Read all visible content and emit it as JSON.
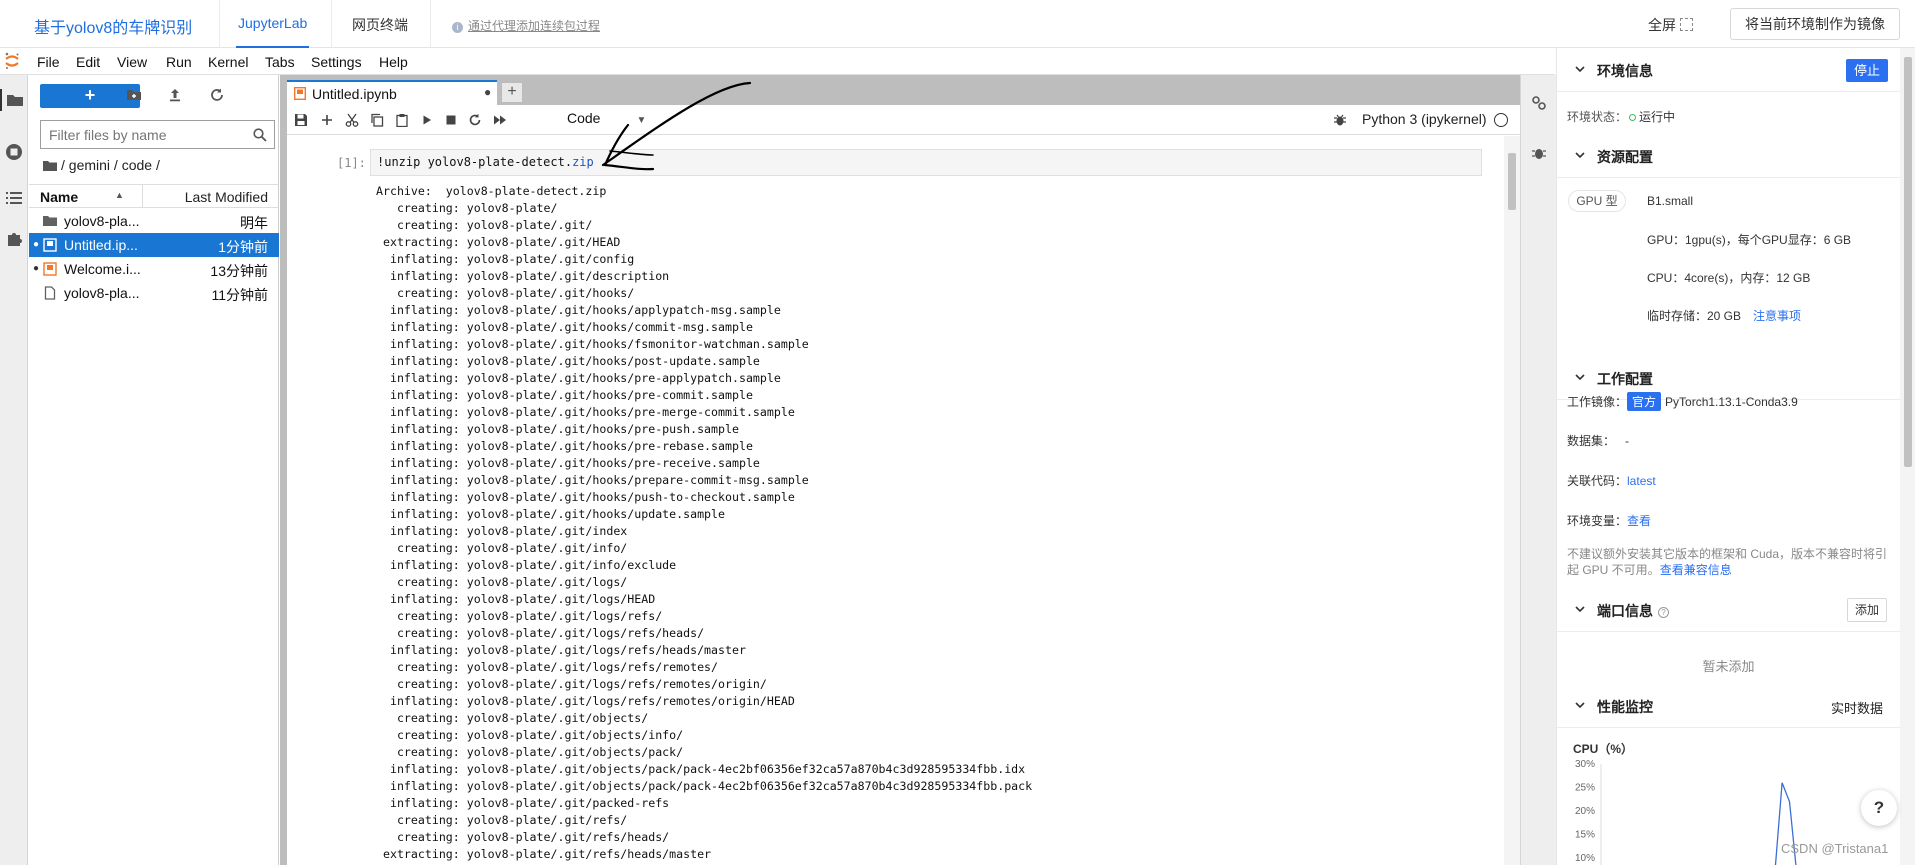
{
  "topbar": {
    "project_name": "基于yolov8的车牌识别",
    "tabs": [
      "JupyterLab",
      "网页终端"
    ],
    "proxy_link": "通过代理添加连续包过程",
    "fullscreen": "全屏",
    "mirror_button": "将当前环境制作为镜像"
  },
  "menu": [
    "File",
    "Edit",
    "View",
    "Run",
    "Kernel",
    "Tabs",
    "Settings",
    "Help"
  ],
  "filebrowser": {
    "new_button": "+",
    "filter_placeholder": "Filter files by name",
    "breadcrumb": "/ gemini / code /",
    "col_name": "Name",
    "col_modified": "Last Modified",
    "files": [
      {
        "name": "yolov8-pla...",
        "modified": "明年",
        "type": "folder",
        "running": false,
        "selected": false
      },
      {
        "name": "Untitled.ip...",
        "modified": "1分钟前",
        "type": "notebook",
        "running": true,
        "selected": true
      },
      {
        "name": "Welcome.i...",
        "modified": "13分钟前",
        "type": "notebook",
        "running": true,
        "selected": false
      },
      {
        "name": "yolov8-pla...",
        "modified": "11分钟前",
        "type": "file",
        "running": false,
        "selected": false
      }
    ]
  },
  "notebook": {
    "tab_name": "Untitled.ipynb",
    "cell_type": "Code",
    "kernel": "Python 3 (ipykernel)",
    "prompt": "[1]:",
    "code_prefix": "!unzip yolov8-plate-detect.",
    "code_ext": "zip",
    "output_lines": [
      "Archive:  yolov8-plate-detect.zip",
      "   creating: yolov8-plate/",
      "   creating: yolov8-plate/.git/",
      " extracting: yolov8-plate/.git/HEAD",
      "  inflating: yolov8-plate/.git/config",
      "  inflating: yolov8-plate/.git/description",
      "   creating: yolov8-plate/.git/hooks/",
      "  inflating: yolov8-plate/.git/hooks/applypatch-msg.sample",
      "  inflating: yolov8-plate/.git/hooks/commit-msg.sample",
      "  inflating: yolov8-plate/.git/hooks/fsmonitor-watchman.sample",
      "  inflating: yolov8-plate/.git/hooks/post-update.sample",
      "  inflating: yolov8-plate/.git/hooks/pre-applypatch.sample",
      "  inflating: yolov8-plate/.git/hooks/pre-commit.sample",
      "  inflating: yolov8-plate/.git/hooks/pre-merge-commit.sample",
      "  inflating: yolov8-plate/.git/hooks/pre-push.sample",
      "  inflating: yolov8-plate/.git/hooks/pre-rebase.sample",
      "  inflating: yolov8-plate/.git/hooks/pre-receive.sample",
      "  inflating: yolov8-plate/.git/hooks/prepare-commit-msg.sample",
      "  inflating: yolov8-plate/.git/hooks/push-to-checkout.sample",
      "  inflating: yolov8-plate/.git/hooks/update.sample",
      "  inflating: yolov8-plate/.git/index",
      "   creating: yolov8-plate/.git/info/",
      "  inflating: yolov8-plate/.git/info/exclude",
      "   creating: yolov8-plate/.git/logs/",
      "  inflating: yolov8-plate/.git/logs/HEAD",
      "   creating: yolov8-plate/.git/logs/refs/",
      "   creating: yolov8-plate/.git/logs/refs/heads/",
      "  inflating: yolov8-plate/.git/logs/refs/heads/master",
      "   creating: yolov8-plate/.git/logs/refs/remotes/",
      "   creating: yolov8-plate/.git/logs/refs/remotes/origin/",
      "  inflating: yolov8-plate/.git/logs/refs/remotes/origin/HEAD",
      "   creating: yolov8-plate/.git/objects/",
      "   creating: yolov8-plate/.git/objects/info/",
      "   creating: yolov8-plate/.git/objects/pack/",
      "  inflating: yolov8-plate/.git/objects/pack/pack-4ec2bf06356ef32ca57a870b4c3d928595334fbb.idx",
      "  inflating: yolov8-plate/.git/objects/pack/pack-4ec2bf06356ef32ca57a870b4c3d928595334fbb.pack",
      "  inflating: yolov8-plate/.git/packed-refs",
      "   creating: yolov8-plate/.git/refs/",
      "   creating: yolov8-plate/.git/refs/heads/",
      " extracting: yolov8-plate/.git/refs/heads/master"
    ]
  },
  "env": {
    "env_info_title": "环境信息",
    "stop_button": "停止",
    "status_label": "环境状态：",
    "status_value": "运行中",
    "resource_title": "资源配置",
    "gpu_type_label": "GPU 型",
    "gpu_type_value": "B1.small",
    "gpu_line": "GPU：1gpu(s)，每个GPU显存：6 GB",
    "cpu_line": "CPU：4core(s)，内存：12 GB",
    "storage_line": "临时存储：20 GB",
    "storage_link": "注意事项",
    "work_title": "工作配置",
    "image_label": "工作镜像：",
    "image_tag": "官方",
    "image_value": "PyTorch1.13.1-Conda3.9",
    "dataset_label": "数据集：",
    "dataset_value": "-",
    "code_label": "关联代码：",
    "code_value": "latest",
    "envvar_label": "环境变量：",
    "envvar_value": "查看",
    "warning_text": "不建议额外安装其它版本的框架和 Cuda，版本不兼容时将引起 GPU 不可用。",
    "warning_link": "查看兼容信息",
    "port_title": "端口信息",
    "add_button": "添加",
    "port_empty": "暂未添加",
    "monitor_title": "性能监控",
    "realtime": "实时数据",
    "cpu_chart_label": "CPU（%）"
  },
  "chart_data": {
    "type": "line",
    "title": "CPU（%）",
    "y_ticks": [
      "30%",
      "25%",
      "20%",
      "15%",
      "10%"
    ],
    "ylim": [
      10,
      30
    ],
    "series": [
      {
        "values": [
          0,
          0,
          0,
          0,
          0,
          0,
          0,
          0,
          0,
          0,
          0,
          0,
          0,
          0,
          0,
          0,
          0,
          0,
          0,
          0,
          0,
          0,
          0,
          0,
          26,
          22,
          0,
          0,
          0,
          0,
          0,
          0,
          0,
          0,
          0,
          0,
          0,
          0,
          0,
          0
        ]
      }
    ],
    "line_color": "#3b6fd4"
  },
  "watermark": "CSDN @Tristana1",
  "help": "?"
}
